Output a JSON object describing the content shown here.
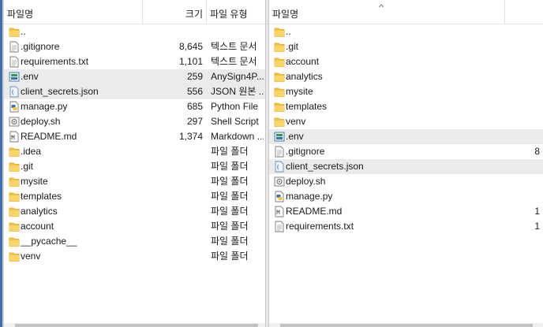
{
  "left_pane": {
    "columns": {
      "name": "파일명",
      "size": "크기",
      "type": "파일 유형"
    },
    "items": [
      {
        "name": "..",
        "size": "",
        "type": "",
        "icon": "folder-icon"
      },
      {
        "name": ".gitignore",
        "size": "8,645",
        "type": "텍스트 문서",
        "icon": "text-file-icon"
      },
      {
        "name": "requirements.txt",
        "size": "1,101",
        "type": "텍스트 문서",
        "icon": "text-file-icon"
      },
      {
        "name": ".env",
        "size": "259",
        "type": "AnySign4P...",
        "icon": "anysign-file-icon",
        "selected": true
      },
      {
        "name": "client_secrets.json",
        "size": "556",
        "type": "JSON 원본 ...",
        "icon": "json-file-icon",
        "selected": true
      },
      {
        "name": "manage.py",
        "size": "685",
        "type": "Python File",
        "icon": "python-file-icon"
      },
      {
        "name": "deploy.sh",
        "size": "297",
        "type": "Shell Script",
        "icon": "shell-script-icon"
      },
      {
        "name": "README.md",
        "size": "1,374",
        "type": "Markdown ...",
        "icon": "markdown-file-icon"
      },
      {
        "name": ".idea",
        "size": "",
        "type": "파일 폴더",
        "icon": "folder-icon"
      },
      {
        "name": ".git",
        "size": "",
        "type": "파일 폴더",
        "icon": "folder-icon"
      },
      {
        "name": "mysite",
        "size": "",
        "type": "파일 폴더",
        "icon": "folder-icon"
      },
      {
        "name": "templates",
        "size": "",
        "type": "파일 폴더",
        "icon": "folder-icon"
      },
      {
        "name": "analytics",
        "size": "",
        "type": "파일 폴더",
        "icon": "folder-icon"
      },
      {
        "name": "account",
        "size": "",
        "type": "파일 폴더",
        "icon": "folder-icon"
      },
      {
        "name": "__pycache__",
        "size": "",
        "type": "파일 폴더",
        "icon": "folder-icon"
      },
      {
        "name": "venv",
        "size": "",
        "type": "파일 폴더",
        "icon": "folder-icon"
      }
    ]
  },
  "right_pane": {
    "columns": {
      "name": "파일명"
    },
    "items": [
      {
        "name": "..",
        "size": "",
        "icon": "folder-icon"
      },
      {
        "name": ".git",
        "size": "",
        "icon": "folder-icon"
      },
      {
        "name": "account",
        "size": "",
        "icon": "folder-icon"
      },
      {
        "name": "analytics",
        "size": "",
        "icon": "folder-icon"
      },
      {
        "name": "mysite",
        "size": "",
        "icon": "folder-icon"
      },
      {
        "name": "templates",
        "size": "",
        "icon": "folder-icon"
      },
      {
        "name": "venv",
        "size": "",
        "icon": "folder-icon"
      },
      {
        "name": ".env",
        "size": "",
        "icon": "anysign-file-icon",
        "selected": true
      },
      {
        "name": ".gitignore",
        "size": "8",
        "icon": "text-file-icon"
      },
      {
        "name": "client_secrets.json",
        "size": "",
        "icon": "json-file-icon",
        "selected": true
      },
      {
        "name": "deploy.sh",
        "size": "",
        "icon": "shell-script-icon"
      },
      {
        "name": "manage.py",
        "size": "",
        "icon": "python-file-icon"
      },
      {
        "name": "README.md",
        "size": "1",
        "icon": "markdown-file-icon"
      },
      {
        "name": "requirements.txt",
        "size": "1",
        "icon": "text-file-icon"
      }
    ]
  },
  "colors": {
    "folder": "#f5c542",
    "selection": "#ebebeb",
    "accent": "#3f6fa8"
  }
}
